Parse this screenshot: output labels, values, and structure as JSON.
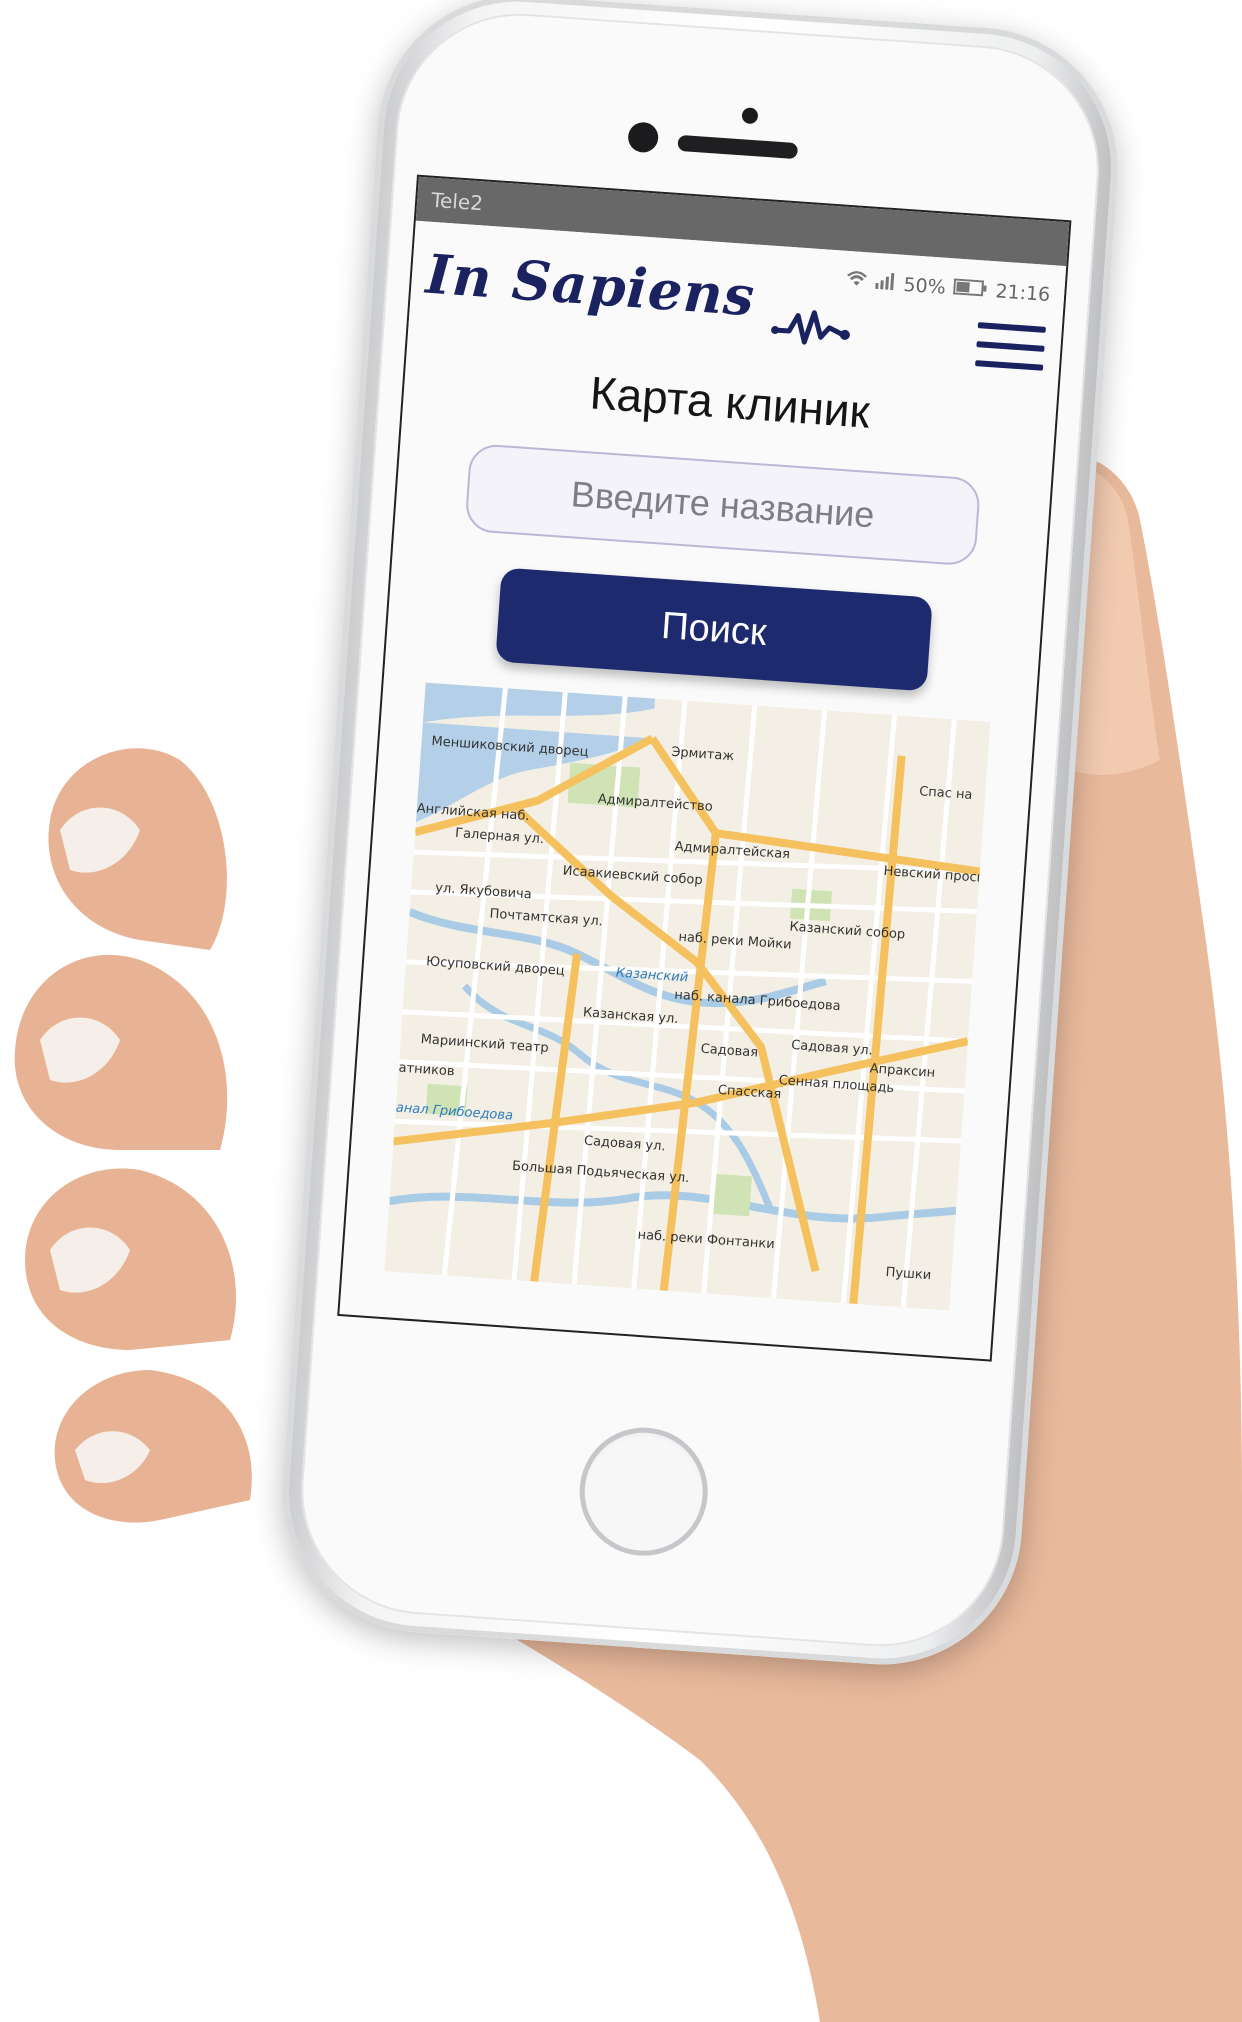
{
  "status_bar": {
    "carrier": "Tele2",
    "battery": "50%",
    "time": "21:16"
  },
  "header": {
    "logo_text": "In Sapiens",
    "pulse_icon": "heartbeat-icon",
    "menu_icon": "hamburger-menu-icon"
  },
  "main": {
    "title": "Карта клиник",
    "search_placeholder": "Введите название",
    "search_button_label": "Поиск"
  },
  "map": {
    "labels": [
      "Эрмитаж",
      "Меншиковский дворец",
      "Адмиралтейство",
      "Спас на",
      "Адмиралтейская",
      "Невский проспект",
      "Галерная ул.",
      "Исаакиевский собор",
      "ул. Якубовича",
      "Почтамтская ул.",
      "Казанский собор",
      "наб. реки Мойки",
      "Юсуповский дворец",
      "Казанский",
      "наб. канала Грибоедова",
      "Казанская ул.",
      "Садовая ул.",
      "Садовая",
      "Апраксин",
      "Мариинский театр",
      "Сенная площадь",
      "Спасская",
      "Садовая ул.",
      "Большая Подьяческая ул.",
      "наб. реки Фонтанки",
      "Пушки",
      "анал Грибоедова",
      "Английская наб.",
      "атников"
    ]
  },
  "colors": {
    "brand": "#1a2260",
    "button": "#1e2a6e",
    "input_border": "#b9b8d6",
    "water": "#b3d0e8",
    "road": "#f4c15e"
  }
}
